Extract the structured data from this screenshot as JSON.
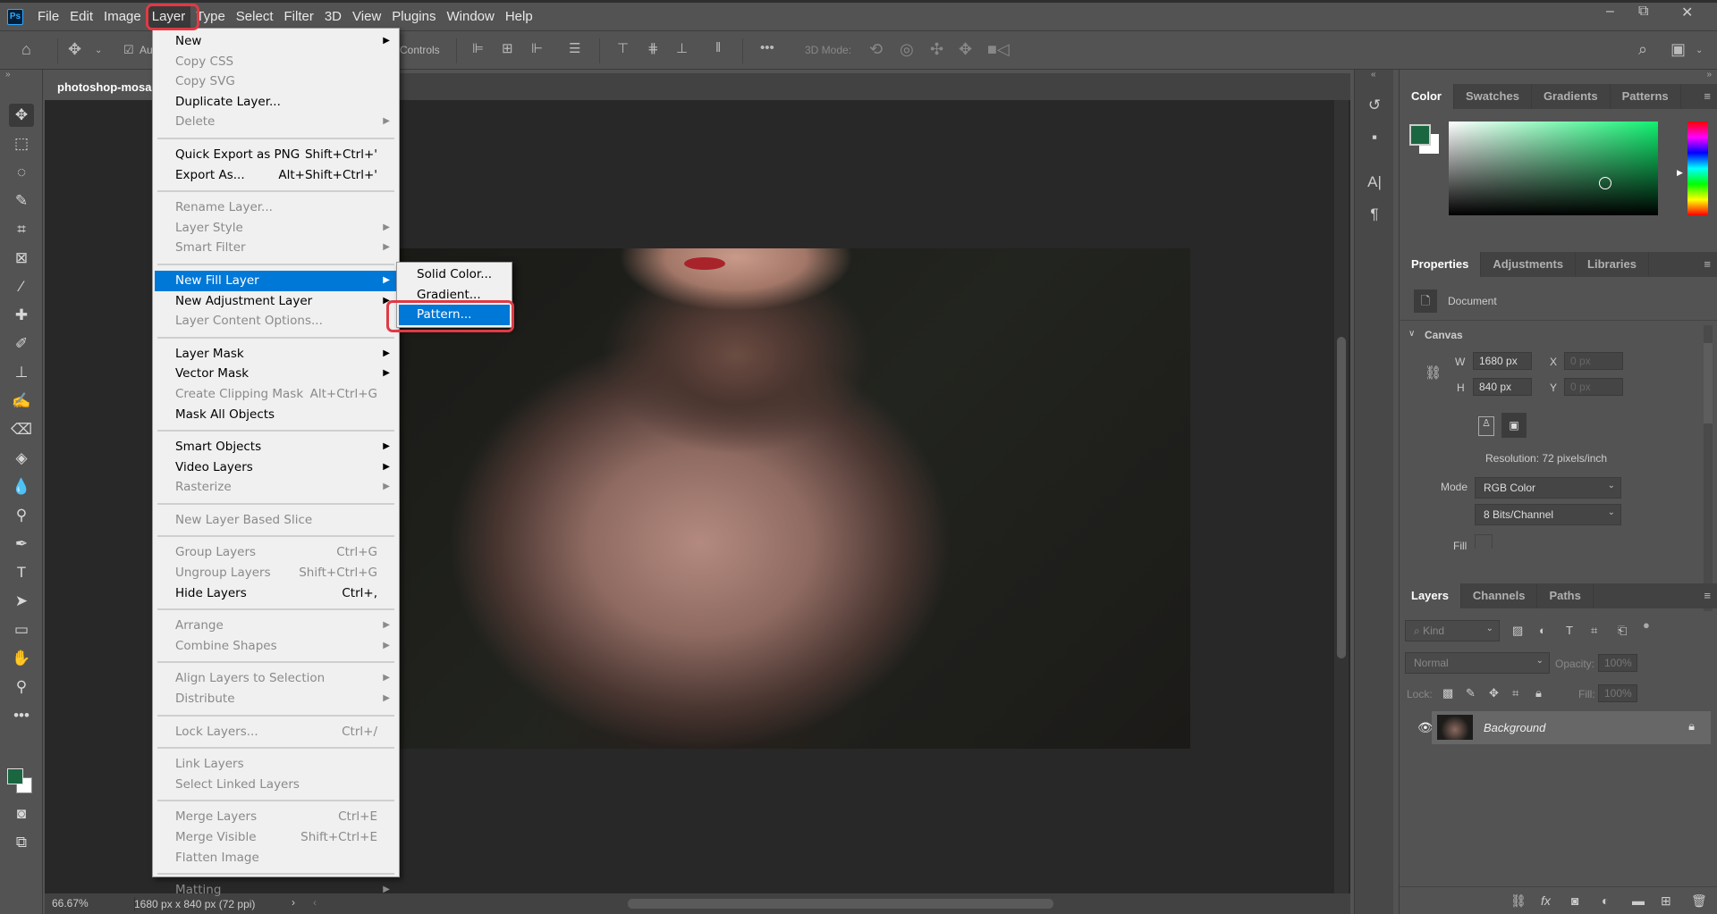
{
  "menubar": {
    "logo": "Ps",
    "items": [
      "File",
      "Edit",
      "Image",
      "Layer",
      "Type",
      "Select",
      "Filter",
      "3D",
      "View",
      "Plugins",
      "Window",
      "Help"
    ],
    "active": "Layer"
  },
  "window_controls": {
    "minimize": "–",
    "restore": "⧉",
    "close": "✕"
  },
  "options_bar": {
    "auto_select_label": "Au",
    "show_transform_label": "Controls",
    "three_d_mode_label": "3D Mode:"
  },
  "document": {
    "tab_title": "photoshop-mosa",
    "zoom": "66.67%",
    "info": "1680 px x 840 px (72 ppi)"
  },
  "layer_menu": {
    "items": [
      {
        "label": "New",
        "arrow": true
      },
      {
        "label": "Copy CSS",
        "disabled": true
      },
      {
        "label": "Copy SVG",
        "disabled": true
      },
      {
        "label": "Duplicate Layer..."
      },
      {
        "label": "Delete",
        "disabled": true,
        "arrow": true
      },
      {
        "sep": true
      },
      {
        "label": "Quick Export as PNG",
        "shortcut": "Shift+Ctrl+'"
      },
      {
        "label": "Export As...",
        "shortcut": "Alt+Shift+Ctrl+'"
      },
      {
        "sep": true
      },
      {
        "label": "Rename Layer...",
        "disabled": true
      },
      {
        "label": "Layer Style",
        "disabled": true,
        "arrow": true
      },
      {
        "label": "Smart Filter",
        "disabled": true,
        "arrow": true
      },
      {
        "sep": true
      },
      {
        "label": "New Fill Layer",
        "arrow": true,
        "highlighted": true
      },
      {
        "label": "New Adjustment Layer",
        "arrow": true
      },
      {
        "label": "Layer Content Options...",
        "disabled": true
      },
      {
        "sep": true
      },
      {
        "label": "Layer Mask",
        "arrow": true
      },
      {
        "label": "Vector Mask",
        "arrow": true
      },
      {
        "label": "Create Clipping Mask",
        "disabled": true,
        "shortcut": "Alt+Ctrl+G"
      },
      {
        "label": "Mask All Objects"
      },
      {
        "sep": true
      },
      {
        "label": "Smart Objects",
        "arrow": true
      },
      {
        "label": "Video Layers",
        "arrow": true
      },
      {
        "label": "Rasterize",
        "disabled": true,
        "arrow": true
      },
      {
        "sep": true
      },
      {
        "label": "New Layer Based Slice",
        "disabled": true
      },
      {
        "sep": true
      },
      {
        "label": "Group Layers",
        "disabled": true,
        "shortcut": "Ctrl+G"
      },
      {
        "label": "Ungroup Layers",
        "disabled": true,
        "shortcut": "Shift+Ctrl+G"
      },
      {
        "label": "Hide Layers",
        "shortcut": "Ctrl+,"
      },
      {
        "sep": true
      },
      {
        "label": "Arrange",
        "disabled": true,
        "arrow": true
      },
      {
        "label": "Combine Shapes",
        "disabled": true,
        "arrow": true
      },
      {
        "sep": true
      },
      {
        "label": "Align Layers to Selection",
        "disabled": true,
        "arrow": true
      },
      {
        "label": "Distribute",
        "disabled": true,
        "arrow": true
      },
      {
        "sep": true
      },
      {
        "label": "Lock Layers...",
        "disabled": true,
        "shortcut": "Ctrl+/"
      },
      {
        "sep": true
      },
      {
        "label": "Link Layers",
        "disabled": true
      },
      {
        "label": "Select Linked Layers",
        "disabled": true
      },
      {
        "sep": true
      },
      {
        "label": "Merge Layers",
        "disabled": true,
        "shortcut": "Ctrl+E"
      },
      {
        "label": "Merge Visible",
        "disabled": true,
        "shortcut": "Shift+Ctrl+E"
      },
      {
        "label": "Flatten Image",
        "disabled": true
      },
      {
        "sep": true
      },
      {
        "label": "Matting",
        "disabled": true,
        "arrow": true
      }
    ]
  },
  "fill_submenu": {
    "items": [
      {
        "label": "Solid Color..."
      },
      {
        "label": "Gradient..."
      },
      {
        "label": "Pattern...",
        "highlighted": true
      }
    ]
  },
  "color_panel": {
    "tabs": [
      "Color",
      "Swatches",
      "Gradients",
      "Patterns"
    ],
    "active": "Color",
    "foreground": "#1a6640",
    "background": "#ffffff"
  },
  "properties_panel": {
    "tabs": [
      "Properties",
      "Adjustments",
      "Libraries"
    ],
    "active": "Properties",
    "doc_label": "Document",
    "section": "Canvas",
    "w_label": "W",
    "w_value": "1680 px",
    "h_label": "H",
    "h_value": "840 px",
    "x_label": "X",
    "x_value": "0 px",
    "y_label": "Y",
    "y_value": "0 px",
    "resolution": "Resolution: 72 pixels/inch",
    "mode_label": "Mode",
    "mode_value": "RGB Color",
    "depth_value": "8 Bits/Channel",
    "fill_label": "Fill"
  },
  "layers_panel": {
    "tabs": [
      "Layers",
      "Channels",
      "Paths"
    ],
    "active": "Layers",
    "filter_placeholder": "Kind",
    "blend_mode": "Normal",
    "opacity_label": "Opacity:",
    "opacity_value": "100%",
    "lock_label": "Lock:",
    "fill_label": "Fill:",
    "fill_value": "100%",
    "layers": [
      {
        "name": "Background",
        "visible": true,
        "locked": true
      }
    ]
  },
  "colors": {
    "highlight": "#0078d7",
    "annotation": "#e03a45"
  }
}
